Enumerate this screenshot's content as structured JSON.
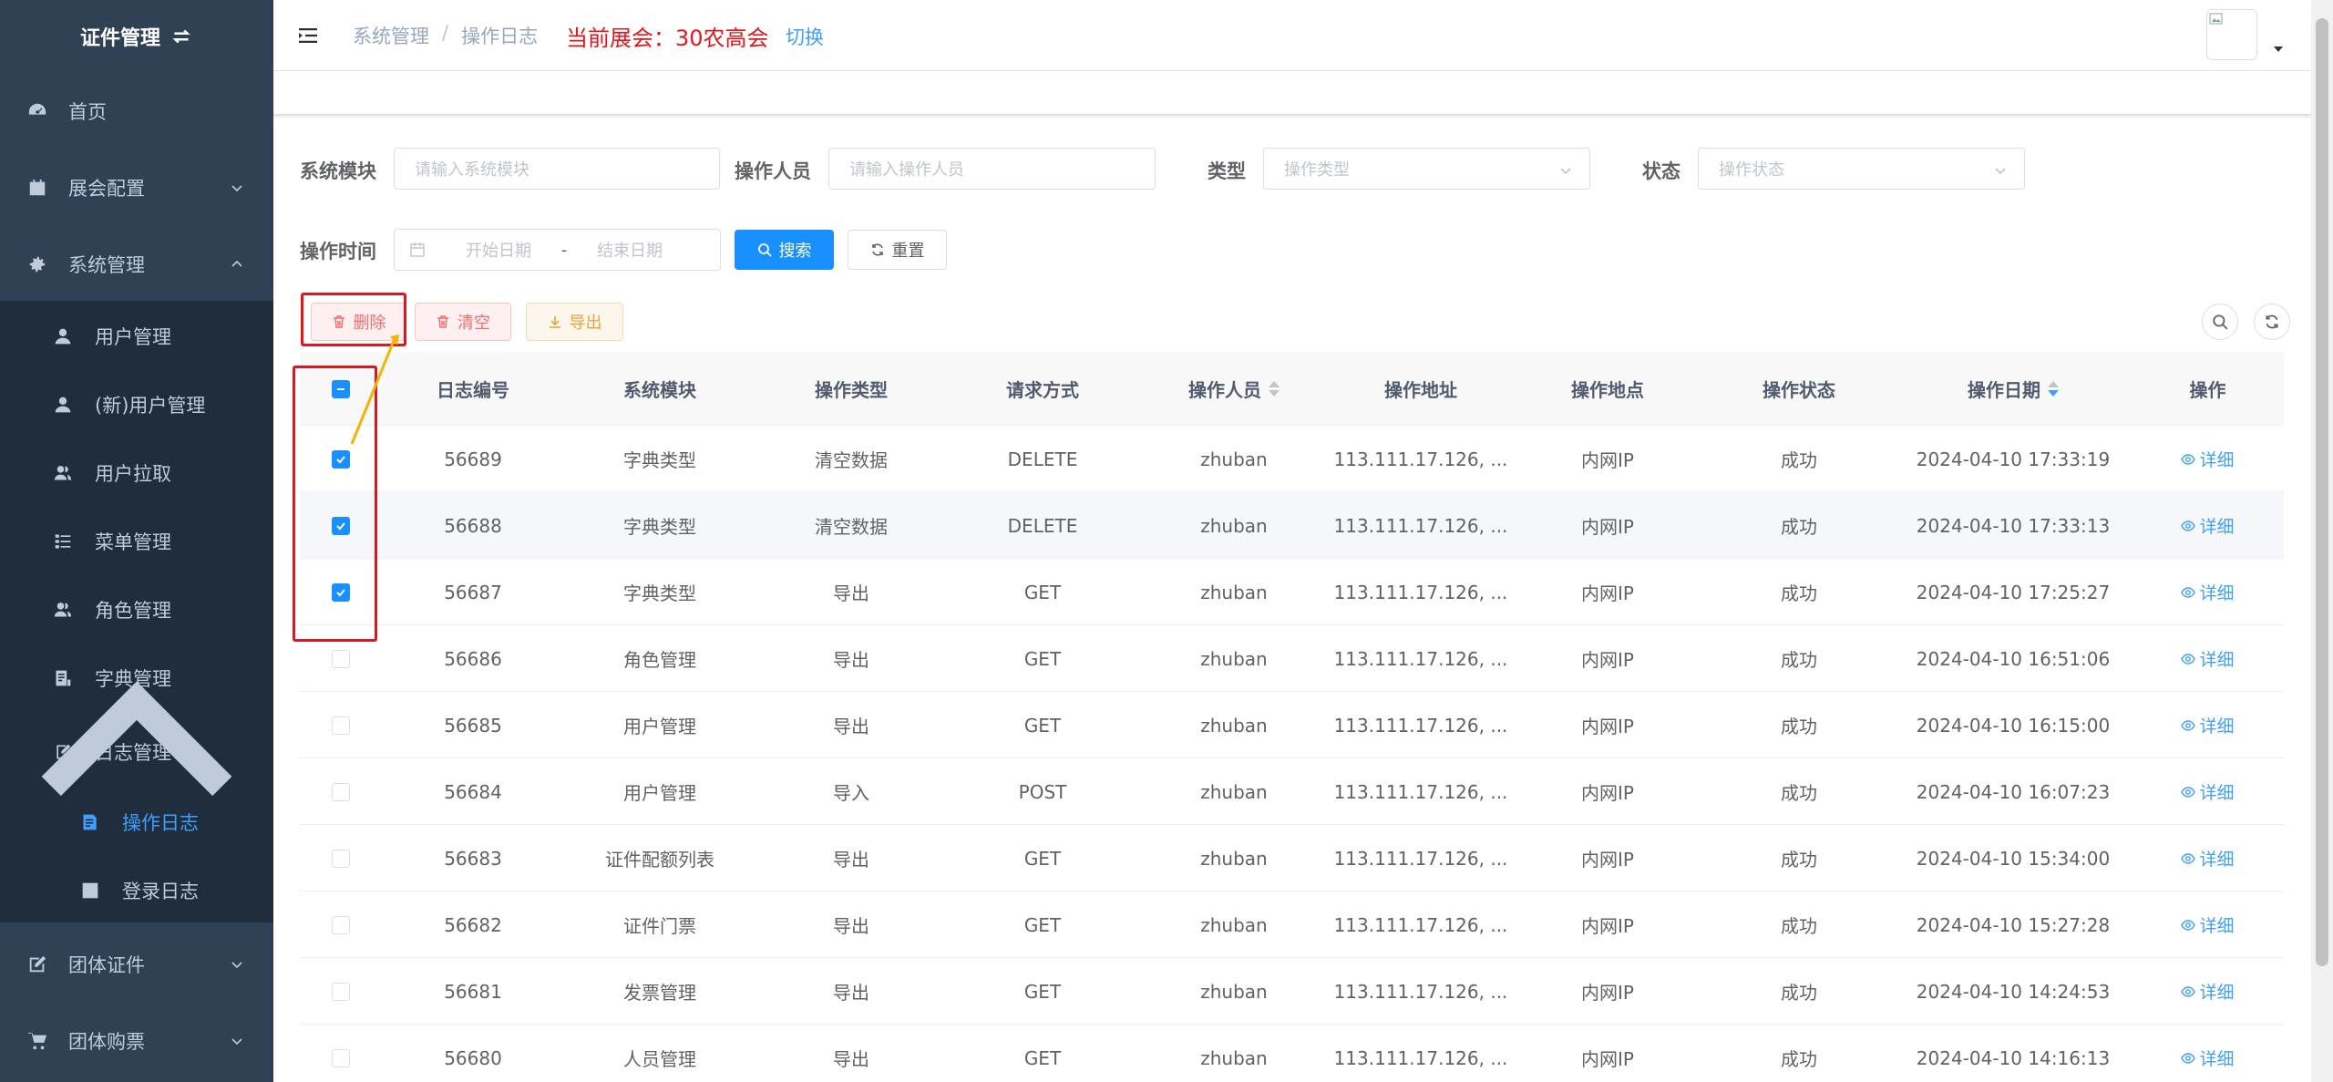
{
  "sidebar": {
    "title": "证件管理",
    "items": [
      {
        "label": "首页",
        "icon": "dashboard-icon"
      },
      {
        "label": "展会配置",
        "icon": "calendar-icon"
      },
      {
        "label": "系统管理",
        "icon": "gear-icon"
      },
      {
        "label": "用户管理",
        "icon": "user-icon"
      },
      {
        "label": "(新)用户管理",
        "icon": "user-icon"
      },
      {
        "label": "用户拉取",
        "icon": "users-icon"
      },
      {
        "label": "菜单管理",
        "icon": "tree-table-icon"
      },
      {
        "label": "角色管理",
        "icon": "peoples-icon"
      },
      {
        "label": "字典管理",
        "icon": "dict-icon"
      },
      {
        "label": "日志管理",
        "icon": "log-icon"
      },
      {
        "label": "操作日志",
        "icon": "form-icon"
      },
      {
        "label": "登录日志",
        "icon": "logininfor-icon"
      },
      {
        "label": "团体证件",
        "icon": "edit-icon"
      },
      {
        "label": "团体购票",
        "icon": "cart-icon"
      }
    ]
  },
  "header": {
    "breadcrumb": [
      "系统管理",
      "/",
      "操作日志"
    ],
    "expo_label": "当前展会：",
    "expo_name": "30农高会",
    "switch_label": "切换"
  },
  "filters": {
    "module_label": "系统模块",
    "module_placeholder": "请输入系统模块",
    "operator_label": "操作人员",
    "operator_placeholder": "请输入操作人员",
    "type_label": "类型",
    "type_placeholder": "操作类型",
    "status_label": "状态",
    "status_placeholder": "操作状态",
    "time_label": "操作时间",
    "start_placeholder": "开始日期",
    "range_separator": "-",
    "end_placeholder": "结束日期",
    "search_label": "搜索",
    "reset_label": "重置"
  },
  "toolbar": {
    "delete_label": "删除",
    "clear_label": "清空",
    "export_label": "导出"
  },
  "table": {
    "columns": [
      "日志编号",
      "系统模块",
      "操作类型",
      "请求方式",
      "操作人员",
      "操作地址",
      "操作地点",
      "操作状态",
      "操作日期",
      "操作"
    ],
    "detail_label": "详细",
    "rows": [
      {
        "id": "56689",
        "module": "字典类型",
        "type": "清空数据",
        "method": "DELETE",
        "operator": "zhuban",
        "ip": "113.111.17.126, ...",
        "location": "内网IP",
        "status": "成功",
        "date": "2024-04-10 17:33:19",
        "checked": true
      },
      {
        "id": "56688",
        "module": "字典类型",
        "type": "清空数据",
        "method": "DELETE",
        "operator": "zhuban",
        "ip": "113.111.17.126, ...",
        "location": "内网IP",
        "status": "成功",
        "date": "2024-04-10 17:33:13",
        "checked": true
      },
      {
        "id": "56687",
        "module": "字典类型",
        "type": "导出",
        "method": "GET",
        "operator": "zhuban",
        "ip": "113.111.17.126, ...",
        "location": "内网IP",
        "status": "成功",
        "date": "2024-04-10 17:25:27",
        "checked": true
      },
      {
        "id": "56686",
        "module": "角色管理",
        "type": "导出",
        "method": "GET",
        "operator": "zhuban",
        "ip": "113.111.17.126, ...",
        "location": "内网IP",
        "status": "成功",
        "date": "2024-04-10 16:51:06",
        "checked": false
      },
      {
        "id": "56685",
        "module": "用户管理",
        "type": "导出",
        "method": "GET",
        "operator": "zhuban",
        "ip": "113.111.17.126, ...",
        "location": "内网IP",
        "status": "成功",
        "date": "2024-04-10 16:15:00",
        "checked": false
      },
      {
        "id": "56684",
        "module": "用户管理",
        "type": "导入",
        "method": "POST",
        "operator": "zhuban",
        "ip": "113.111.17.126, ...",
        "location": "内网IP",
        "status": "成功",
        "date": "2024-04-10 16:07:23",
        "checked": false
      },
      {
        "id": "56683",
        "module": "证件配额列表",
        "type": "导出",
        "method": "GET",
        "operator": "zhuban",
        "ip": "113.111.17.126, ...",
        "location": "内网IP",
        "status": "成功",
        "date": "2024-04-10 15:34:00",
        "checked": false
      },
      {
        "id": "56682",
        "module": "证件门票",
        "type": "导出",
        "method": "GET",
        "operator": "zhuban",
        "ip": "113.111.17.126, ...",
        "location": "内网IP",
        "status": "成功",
        "date": "2024-04-10 15:27:28",
        "checked": false
      },
      {
        "id": "56681",
        "module": "发票管理",
        "type": "导出",
        "method": "GET",
        "operator": "zhuban",
        "ip": "113.111.17.126, ...",
        "location": "内网IP",
        "status": "成功",
        "date": "2024-04-10 14:24:53",
        "checked": false
      },
      {
        "id": "56680",
        "module": "人员管理",
        "type": "导出",
        "method": "GET",
        "operator": "zhuban",
        "ip": "113.111.17.126, ...",
        "location": "内网IP",
        "status": "成功",
        "date": "2024-04-10 14:16:13",
        "checked": false
      }
    ]
  },
  "colors": {
    "sidebar_bg": "#304156",
    "submenu_bg": "#1f2d3d",
    "accent": "#1890ff",
    "annotation_red": "#e5141b",
    "annotation_arrow": "#f5b400"
  }
}
